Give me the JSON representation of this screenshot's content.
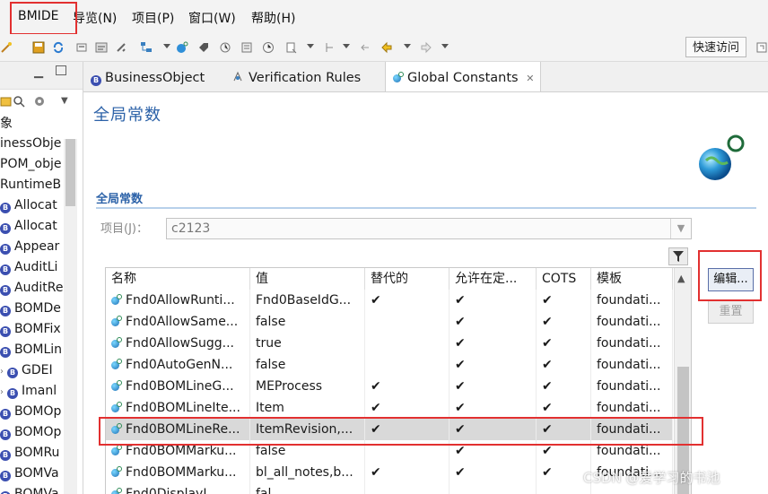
{
  "menu": {
    "items": [
      "BMIDE",
      "导览(N)",
      "项目(P)",
      "窗口(W)",
      "帮助(H)"
    ]
  },
  "toolbar": {
    "quick_access": "快速访问"
  },
  "left_panel": {
    "items": [
      {
        "label": "象",
        "kind": "text"
      },
      {
        "label": "inessObje",
        "kind": "text"
      },
      {
        "label": "POM_obje",
        "kind": "text"
      },
      {
        "label": "RuntimeB",
        "kind": "text"
      },
      {
        "label": "Allocat",
        "kind": "bo"
      },
      {
        "label": "Allocat",
        "kind": "bo"
      },
      {
        "label": "Appear",
        "kind": "bo"
      },
      {
        "label": "AuditLi",
        "kind": "bo"
      },
      {
        "label": "AuditRe",
        "kind": "bo"
      },
      {
        "label": "BOMDe",
        "kind": "bo"
      },
      {
        "label": "BOMFix",
        "kind": "bo"
      },
      {
        "label": "BOMLin",
        "kind": "bo"
      },
      {
        "label": "GDEI",
        "kind": "bo-child"
      },
      {
        "label": "Imanl",
        "kind": "bo-child"
      },
      {
        "label": "BOMOp",
        "kind": "bo"
      },
      {
        "label": "BOMOp",
        "kind": "bo"
      },
      {
        "label": "BOMRu",
        "kind": "bo"
      },
      {
        "label": "BOMVa",
        "kind": "bo"
      },
      {
        "label": "BOMVa",
        "kind": "bo"
      }
    ]
  },
  "tabs": [
    {
      "label": "BusinessObject",
      "icon": "business-object-icon"
    },
    {
      "label": "Verification Rules",
      "icon": "verification-icon"
    },
    {
      "label": "Global Constants",
      "icon": "constant-icon",
      "active": true,
      "close": "✕"
    }
  ],
  "editor": {
    "title": "全局常数",
    "section": "全局常数",
    "project_label": "项目(J)：",
    "project_value": "c2123",
    "columns": [
      "名称",
      "值",
      "替代的",
      "允许在定...",
      "COTS",
      "模板"
    ],
    "rows": [
      {
        "name": "Fnd0AllowRunti...",
        "value": "Fnd0BaseIdG...",
        "override": "✔",
        "allow": "✔",
        "cots": "✔",
        "template": "foundati..."
      },
      {
        "name": "Fnd0AllowSame...",
        "value": "false",
        "override": "",
        "allow": "✔",
        "cots": "✔",
        "template": "foundati..."
      },
      {
        "name": "Fnd0AllowSugg...",
        "value": "true",
        "override": "",
        "allow": "✔",
        "cots": "✔",
        "template": "foundati..."
      },
      {
        "name": "Fnd0AutoGenN...",
        "value": "false",
        "override": "",
        "allow": "✔",
        "cots": "✔",
        "template": "foundati..."
      },
      {
        "name": "Fnd0BOMLineG...",
        "value": "MEProcess",
        "override": "✔",
        "allow": "✔",
        "cots": "✔",
        "template": "foundati..."
      },
      {
        "name": "Fnd0BOMLineIte...",
        "value": "Item",
        "override": "✔",
        "allow": "✔",
        "cots": "✔",
        "template": "foundati..."
      },
      {
        "name": "Fnd0BOMLineRe...",
        "value": "ItemRevision,...",
        "override": "✔",
        "allow": "✔",
        "cots": "✔",
        "template": "foundati...",
        "selected": true
      },
      {
        "name": "Fnd0BOMMarku...",
        "value": "false",
        "override": "",
        "allow": "✔",
        "cots": "✔",
        "template": "foundati..."
      },
      {
        "name": "Fnd0BOMMarku...",
        "value": "bl_all_notes,b...",
        "override": "✔",
        "allow": "✔",
        "cots": "✔",
        "template": "foundati..."
      },
      {
        "name": "Fnd0DisplayI...",
        "value": "fal...",
        "override": "",
        "allow": "",
        "cots": "",
        "template": ""
      }
    ],
    "edit_button": "编辑...",
    "reset_button": "重置"
  },
  "watermark": "CSDN @爱学习的书池",
  "colors": {
    "accent_blue": "#2c62a8",
    "highlight_red": "#e23030",
    "selected_row": "#d9d9d9"
  }
}
